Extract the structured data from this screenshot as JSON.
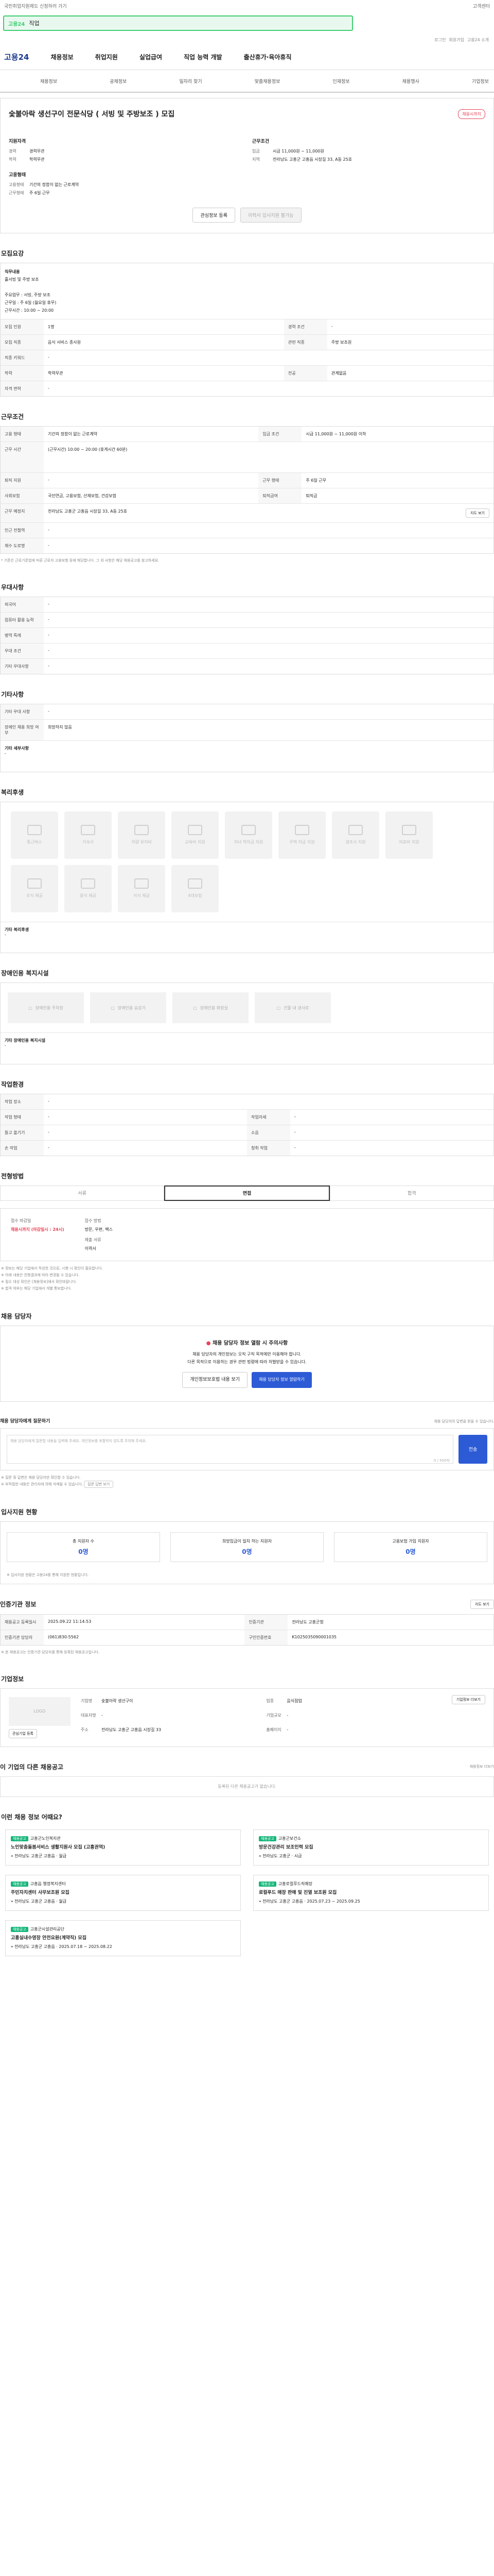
{
  "banner": {
    "left": "국민취업지원제도 신청하러 가기",
    "right": "고객센터"
  },
  "search": {
    "logo": "고용24",
    "value": "직업"
  },
  "toplinks": [
    "로그인",
    "회원가입",
    "고용24 소개"
  ],
  "gnb": {
    "logo": "고용24",
    "items": [
      "채용정보",
      "취업지원",
      "실업급여",
      "직업 능력 개발",
      "출산휴가·육아휴직"
    ]
  },
  "subnav": [
    "채용정보",
    "공채정보",
    "일자리 찾기",
    "맞춤채용정보",
    "인재정보",
    "채용행사",
    "기업정보"
  ],
  "job": {
    "title": "숯불아락 생선구이 전문식당 ( 서빙 및 주방보조 ) 모집",
    "badge": "채용시까지",
    "left": {
      "h1": "지원자격",
      "rows": [
        [
          "경력",
          "경력무관"
        ],
        [
          "학력",
          "학력무관"
        ]
      ],
      "h2": "고용형태",
      "rows2": [
        [
          "고용형태",
          "기간의 정함이 없는 근로계약"
        ],
        [
          "근무형태",
          "주 6일 근무"
        ]
      ]
    },
    "right": {
      "h1": "근무조건",
      "rows": [
        [
          "임금",
          "시급 11,000원 ~ 11,000원"
        ],
        [
          "지역",
          "전라남도 고흥군 고흥읍 시장길 33, A동 25호"
        ]
      ]
    },
    "btns": [
      "관심정보 등록",
      "이력서 입사지원 불가능"
    ]
  },
  "recruit": {
    "title": "모집요강",
    "job_desc_label": "직무내용",
    "job_desc": "홀서빙 및 주방 보조\n\n주요업무 : 서빙, 주방 보조\n근무일 : 주 6일 (월요일 휴무)\n근무시간 : 10:00 ~ 20:00",
    "rows": [
      [
        "모집 인원",
        "1명",
        "경력 조건",
        "-"
      ],
      [
        "모집 직종",
        "음식 서비스 종사원",
        "관련 직종",
        "주방 보조원"
      ],
      [
        "직종 키워드",
        "-"
      ],
      [
        "학력",
        "학력무관",
        "전공",
        "관계없음"
      ],
      [
        "자격 면허",
        "-"
      ]
    ]
  },
  "work": {
    "title": "근무조건",
    "rows": [
      [
        "고용 형태",
        "기간의 정함이 없는 근로계약",
        "임금 조건",
        "시급 11,000원 ~ 11,000원 이하"
      ],
      [
        "근무 시간",
        "(근무시간) 10:00 ~ 20:00 (휴게시간 60분)"
      ],
      [
        "퇴직 지원",
        "-",
        "근무 형태",
        "주 6일 근무"
      ],
      [
        "사회보험",
        "국민연금, 고용보험, 산재보험, 건강보험",
        "퇴직급여",
        "퇴직금"
      ],
      [
        "근무 예정지",
        "전라남도 고흥군 고흥읍 시장길 33, A동 25호"
      ],
      [
        "인근 전철역",
        "-"
      ],
      [
        "재수 도로명",
        "-"
      ]
    ],
    "map_btn": "지도 보기",
    "note": "* 기준은 근로기준법에 따른 근로자 고용보험 등에 해당합니다. 그 외 사항은 해당 채용공고를 참고하세요."
  },
  "pref": {
    "title": "우대사항",
    "rows": [
      [
        "외국어",
        "-"
      ],
      [
        "컴퓨터 활용 능력",
        "-"
      ],
      [
        "병역 특례",
        "-"
      ],
      [
        "우대 조건",
        "-"
      ],
      [
        "기타 우대사항",
        "-"
      ]
    ]
  },
  "other": {
    "title": "기타사항",
    "rows": [
      [
        "기타 우대 사항",
        "-"
      ],
      [
        "장애인 채용 희망 여부",
        "희망하지 않음"
      ]
    ],
    "desc_label": "기타 세부사항",
    "desc": "-"
  },
  "welfare": {
    "title": "복리후생",
    "items": [
      "통근버스",
      "기숙사",
      "차량 유지비",
      "교육비 지원",
      "자녀 학자금 지원",
      "주택 자금 지원",
      "경조사 지원",
      "의료비 지원",
      "조식 제공",
      "중식 제공",
      "석식 제공",
      "4대보험"
    ],
    "etc_label": "기타 복리후생",
    "etc": "-"
  },
  "disab": {
    "title": "장애인용 복지시설",
    "items": [
      "장애인용 주차장",
      "장애인용 승강기",
      "장애인용 화장실",
      "건물 내 경사로"
    ],
    "etc_label": "기타 장애인용 복지시설",
    "etc": "-"
  },
  "env": {
    "title": "작업환경",
    "rows": [
      [
        "작업 장소",
        "-"
      ],
      [
        "작업 형태",
        "-",
        "작업자세",
        "-"
      ],
      [
        "들고 옮기기",
        "-",
        "소음",
        "-"
      ],
      [
        "손 작업",
        "-",
        "청취 작업",
        "-"
      ]
    ]
  },
  "method": {
    "title": "전형방법",
    "tabs": [
      "서류",
      "면접",
      "합격"
    ],
    "deadline_label": "접수 마감일",
    "deadline": "채용시까지 (마감일시 : 24시)",
    "ways_label": "접수 방법",
    "ways": "방문, 우편, 팩스",
    "docs_label": "제출 서류",
    "docs": "이력서",
    "notes": [
      "※ 정보는 해당 기업에서 작성한 것으로, 시행 시 확인이 필요합니다.",
      "※ 아래 내용은 전형결과에 따라 변경될 수 있습니다.",
      "※ 접수 대상 확인은 [채용정보]에서 확인바랍니다.",
      "※ 합격 여부는 해당 기업에서 개별 통보합니다."
    ]
  },
  "inquiry": {
    "title": "채용 담당자",
    "warn": "채용 담당자 정보 열람 시 주의사항",
    "desc1": "채용 담당자의 개인정보는 오직 구직 목적에만 이용해야 합니다.",
    "desc2": "다른 목적으로 이용하는 경우 관련 법령에 따라 처벌받을 수 있습니다.",
    "btn1": "개인정보보호법 내용 보기",
    "btn2": "채용 담당자 정보 열람하기"
  },
  "question": {
    "title": "채용 담당자에게 질문하기",
    "hint": "채용 담당자의 답변을 받을 수 있습니다.",
    "placeholder": "채용 담당자에게 질문할 내용을 입력해 주세요. 개인정보를 포함하지 않도록 주의해 주세요.",
    "count": "0 / 500자",
    "submit": "전송",
    "notes": [
      "※ 질문 및 답변은 채용 담당자만 확인할 수 있습니다.",
      "※ 부적절한 내용은 관리자에 의해 삭제될 수 있습니다."
    ],
    "view": "질문 답변 보기"
  },
  "apply": {
    "title": "입사지원 현황",
    "items": [
      [
        "총 지원자 수",
        "0명"
      ],
      [
        "희망임금이 일치 하는 지원자",
        "0명"
      ],
      [
        "고용보험 가입 지원자",
        "0명"
      ]
    ],
    "note": "※ 입사지원 현황은 고용24를 통해 지원한 현황입니다."
  },
  "agency": {
    "title": "인증기관 정보",
    "rows": [
      [
        "채용공고 등록일시",
        "2025.09.22 11:14:53",
        "인증기관",
        "전라남도 고흥군청"
      ],
      [
        "인증기관 담당자",
        "(061)830-5562",
        "구인인증번호",
        "K1025035090001035"
      ]
    ],
    "btn": "지도 보기",
    "note": "※ 본 채용공고는 인증기관 담당자를 통해 등록된 채용공고입니다."
  },
  "company": {
    "title": "기업정보",
    "logo": "LOGO",
    "rows": [
      [
        "기업명",
        "숯불아락 생선구이"
      ],
      [
        "업종",
        "음식점업"
      ],
      [
        "대표자명",
        "-"
      ],
      [
        "기업규모",
        "-"
      ],
      [
        "주소",
        "전라남도 고흥군 고흥읍 시장길 33"
      ],
      [
        "홈페이지",
        "-"
      ]
    ],
    "btn": "기업정보 더보기",
    "btn2": "관심기업 등록"
  },
  "other_jobs": {
    "title": "이 기업의 다른 채용공고",
    "empty": "등록된 다른 채용공고가 없습니다.",
    "more": "채용정보 더보기"
  },
  "reco": {
    "title": "이런 채용 정보 어때요?",
    "items": [
      {
        "tag": "채용공고",
        "org": "고흥군노인복지관",
        "title": "노인맞춤돌봄서비스 생활지원사 모집 (고흥권역)",
        "loc": "전라남도 고흥군 고흥읍",
        "pay": "월급"
      },
      {
        "tag": "채용공고",
        "org": "고흥군보건소",
        "title": "방문건강관리 보조인력 모집",
        "loc": "전라남도 고흥군",
        "pay": "시급"
      },
      {
        "tag": "채용공고",
        "org": "고흥읍 행정복지센터",
        "title": "주민자치센터 사무보조원 모집",
        "loc": "전라남도 고흥군 고흥읍",
        "pay": "월급"
      },
      {
        "tag": "채용공고",
        "org": "고흥로컬푸드직매장",
        "title": "로컬푸드 매장 판매 및 진열 보조원 모집",
        "loc": "전라남도 고흥군 고흥읍",
        "pay": "2025.07.23 ~ 2025.09.25"
      },
      {
        "tag": "채용공고",
        "org": "고흥군시설관리공단",
        "title": "고흥실내수영장 안전요원(계약직) 모집",
        "loc": "전라남도 고흥군 고흥읍",
        "pay": "2025.07.18 ~ 2025.08.22"
      }
    ]
  }
}
